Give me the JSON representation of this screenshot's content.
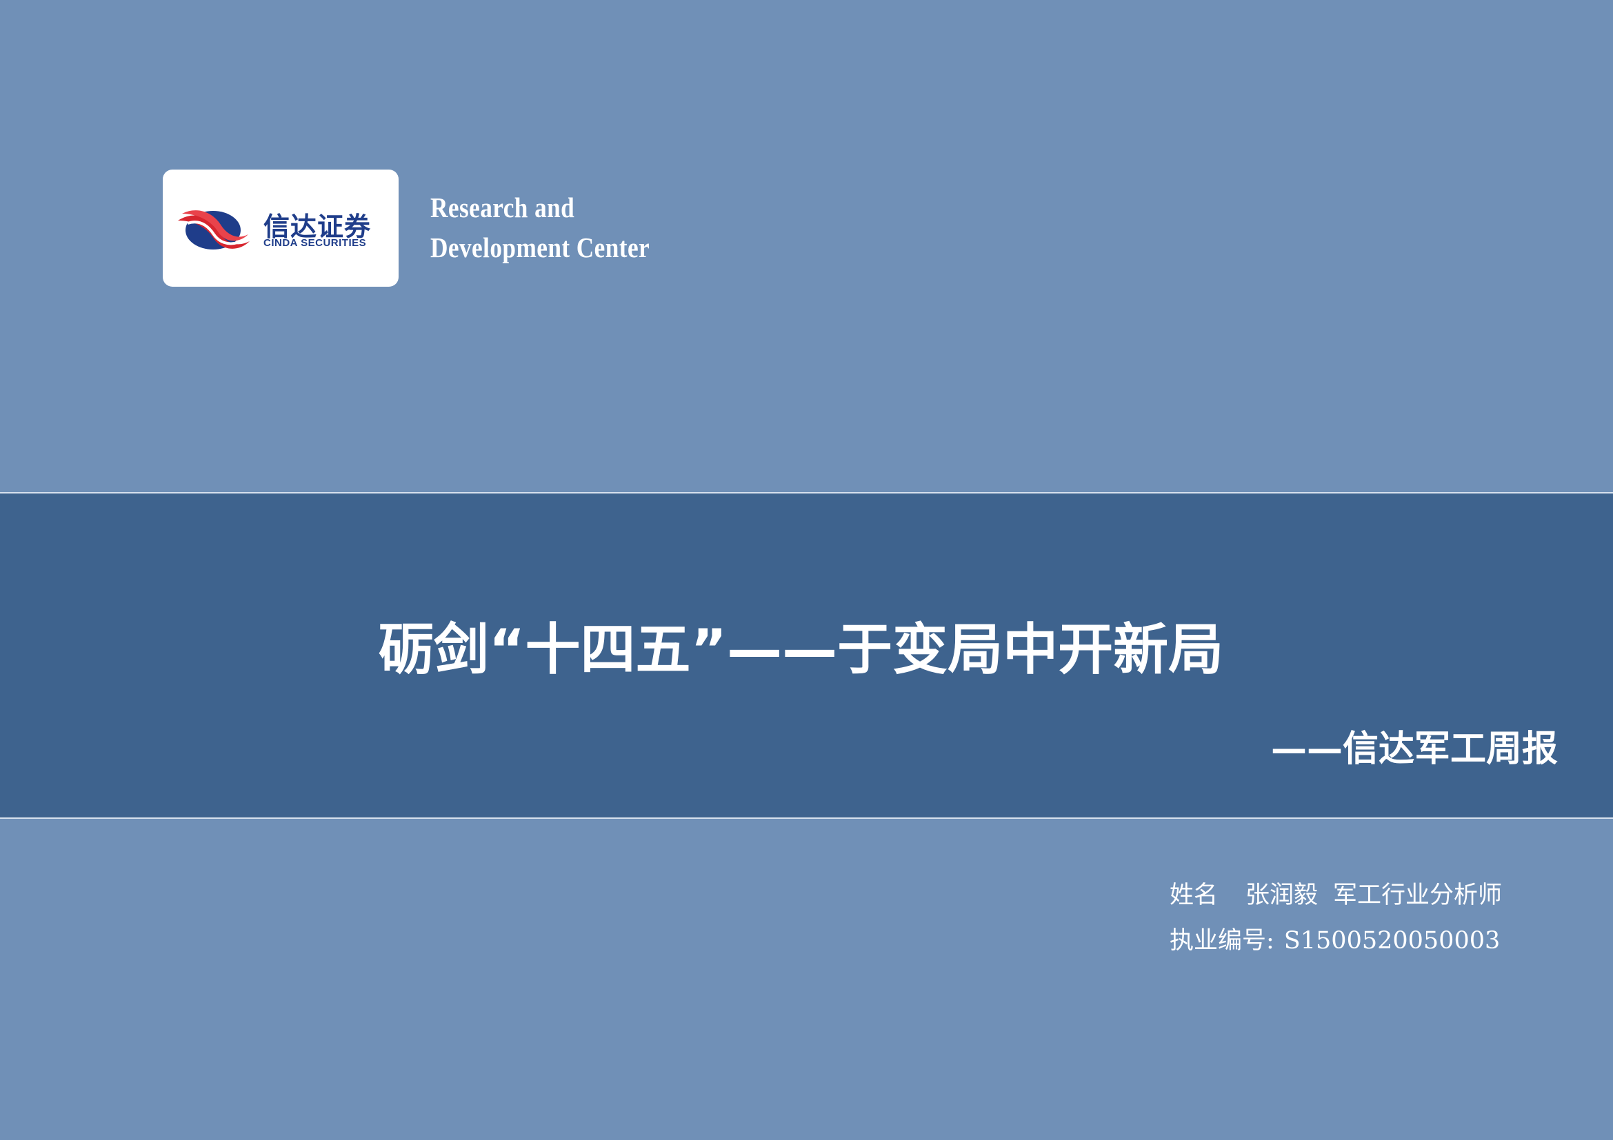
{
  "logo": {
    "name_cn": "信达证券",
    "name_en": "CINDA SECURITIES",
    "brand_red": "#d7262f",
    "brand_blue": "#1f3d8a"
  },
  "center": {
    "line1": "Research and",
    "line2": "Development Center"
  },
  "report": {
    "title": "砺剑“十四五”——于变局中开新局",
    "subtitle": "——信达军工周报"
  },
  "analyst": {
    "name_label": "姓名",
    "name": "张润毅",
    "role": "军工行业分析师",
    "license_label": "执业编号:",
    "license_no": "S1500520050003"
  },
  "colors": {
    "background": "#7090b7",
    "band": "#3e638e",
    "band_border": "#d8e2ee",
    "text": "#ffffff"
  }
}
